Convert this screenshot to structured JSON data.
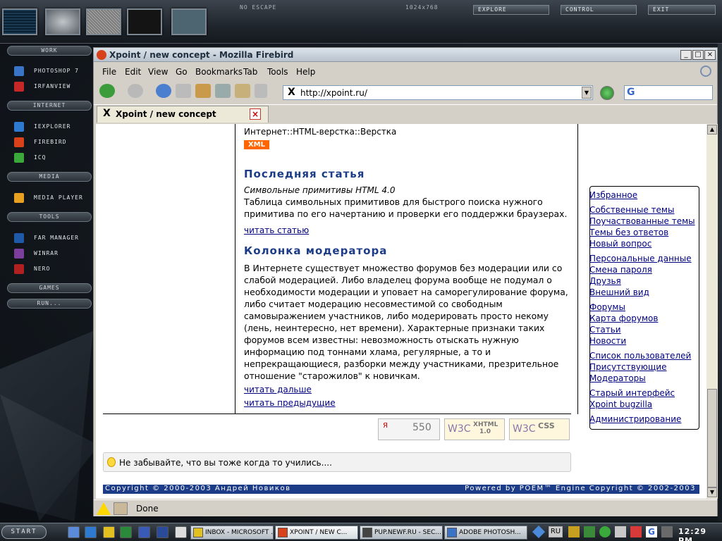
{
  "desktop": {
    "top_label": "NO ESCAPE",
    "resolution": "1024x768",
    "top_buttons": [
      "EXPLORE",
      "CONTROL",
      "EXIT"
    ],
    "sidebar": [
      {
        "section": "WORK",
        "items": [
          "PHOTOSHOP 7",
          "IRFANVIEW"
        ]
      },
      {
        "section": "INTERNET",
        "items": [
          "IEXPLORER",
          "FIREBIRD",
          "ICQ"
        ]
      },
      {
        "section": "MEDIA",
        "items": [
          "MEDIA PLAYER"
        ]
      },
      {
        "section": "TOOLS",
        "items": [
          "FAR MANAGER",
          "WINRAR",
          "NERO"
        ]
      },
      {
        "section": "GAMES",
        "items": []
      },
      {
        "section": "RUN...",
        "items": []
      }
    ]
  },
  "browser": {
    "window_title": "Xpoint / new concept - Mozilla Firebird",
    "menu": [
      "File",
      "Edit",
      "View",
      "Go",
      "Bookmarks",
      "Tab",
      "Tools",
      "Help"
    ],
    "url": "http://xpoint.ru/",
    "search_value": "G",
    "tab_title": "Xpoint / new concept",
    "status": "Done"
  },
  "content": {
    "category": "Интернет::HTML-верстка::Верстка",
    "xml_badge": "XML",
    "last_article": {
      "heading": "Последняя статья",
      "title": "Символьные примитивы HTML 4.0",
      "text": "Таблица символьных примитивов для быстрого поиска нужного примитива по его начертанию и проверки его поддержки браузерах.",
      "link": "читать статью"
    },
    "moderator": {
      "heading": "Колонка модератора",
      "text": "В Интернете существует множество форумов без модерации или со слабой модерацией. Либо владелец форума вообще не подумал о необходимости модерации и уповает на саморегулирование форума, либо считает модерацию несовместимой со свободным самовыражением участников, либо модерировать просто некому (лень, неинтересно, нет времени). Характерные признаки таких форумов всем известны: невозможность отыскать нужную информацию под тоннами хлама, регулярные, а то и непрекращающиеся, разборки между участниками, презрительное отношение \"старожилов\" к новичкам.",
      "link_more": "читать дальше",
      "link_prev": "читать предыдущие"
    },
    "badges": {
      "counter": "550",
      "xhtml": "XHTML 1.0",
      "css": "CSS",
      "w3c": "W3C"
    },
    "hint": "Не забывайте, что вы тоже когда то учились....",
    "footer_left": "Copyright © 2000-2003 Андрей Новиков",
    "footer_right": "Powered by POEM™ Engine Copyright © 2002-2003",
    "right_menu": [
      [
        "Избранное"
      ],
      [
        "Собственные темы",
        "Поучаствованные темы",
        "Темы без ответов",
        "Новый вопрос"
      ],
      [
        "Персональные данные",
        "Смена пароля",
        "Друзья",
        "Внешний вид"
      ],
      [
        "Форумы",
        "Карта форумов",
        "Статьи",
        "Новости"
      ],
      [
        "Список пользователей",
        "Присутствующие",
        "Модераторы"
      ],
      [
        "Старый интерфейс",
        "Xpoint bugzilla"
      ],
      [
        "Администрирование"
      ]
    ]
  },
  "taskbar": {
    "start": "START",
    "tasks": [
      "INBOX - MICROSOFT ...",
      "XPOINT / NEW C...",
      "PUP.NEWF.RU - SEC...",
      "ADOBE PHOTOSH..."
    ],
    "language": "RU",
    "clock": "12:29 PM"
  }
}
